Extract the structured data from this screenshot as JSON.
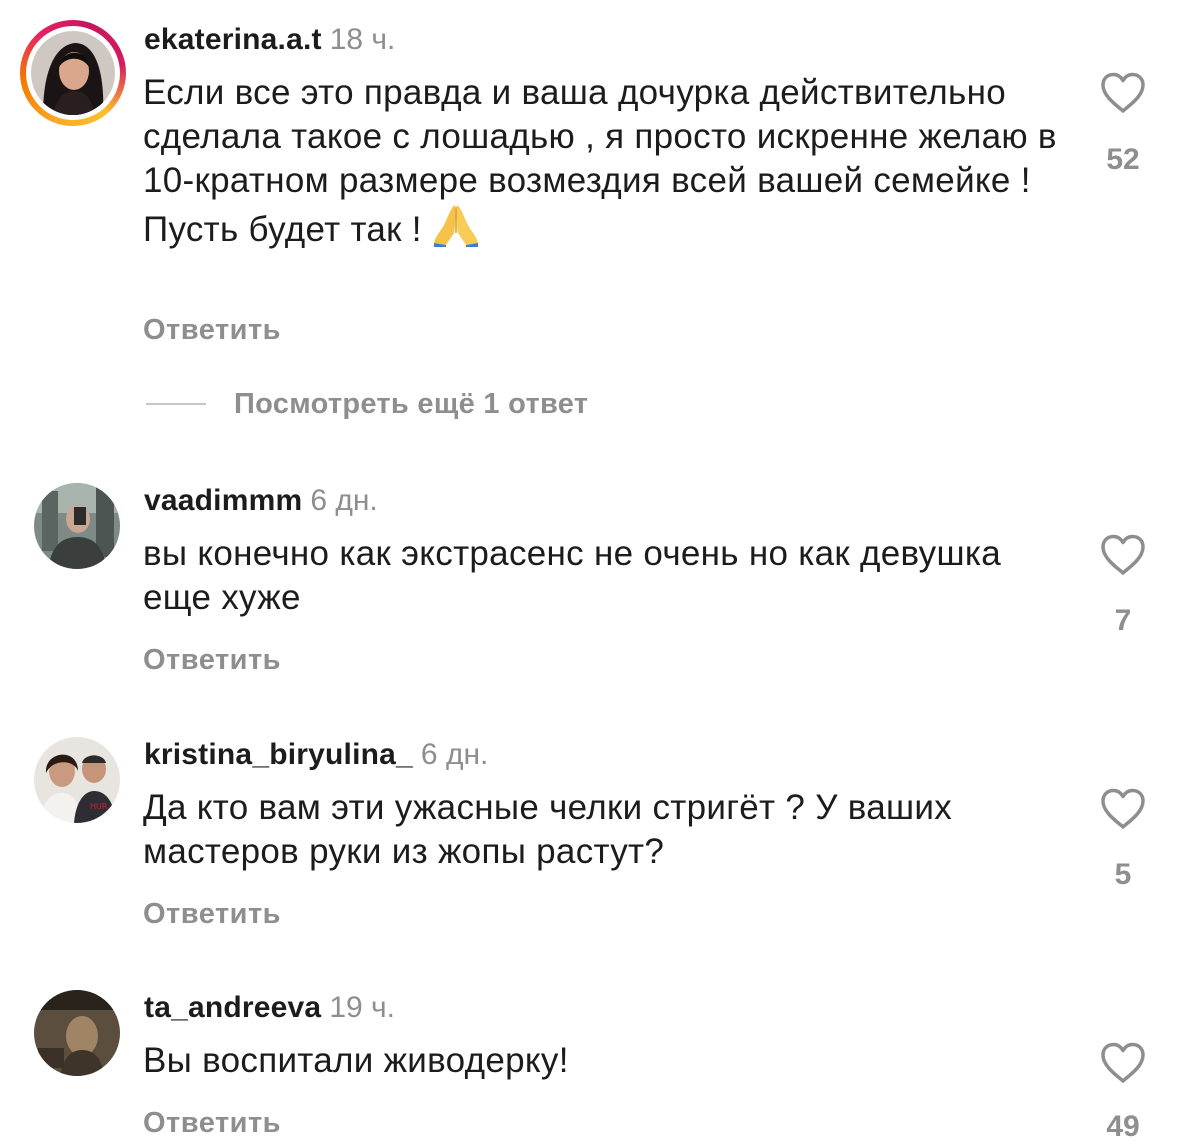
{
  "comments": [
    {
      "username": "ekaterina.a.t",
      "time": "18 ч.",
      "text": "Если все это правда и ваша дочурка действительно сделала такое с лошадью , я просто искренне желаю в 10-кратном размере возмездия всей вашей семейке ! Пусть будет так !",
      "emoji": "folded-hands-emoji",
      "likes": "52",
      "reply_label": "Ответить",
      "has_story_ring": true
    },
    {
      "username": "vaadimmm",
      "time": "6 дн.",
      "text": "вы конечно как экстрасенс не очень но как девушка еще хуже",
      "likes": "7",
      "reply_label": "Ответить"
    },
    {
      "username": "kristina_biryulina_",
      "time": "6 дн.",
      "text": "Да кто вам эти ужасные челки стригёт ? У ваших мастеров руки из жопы растут?",
      "likes": "5",
      "reply_label": "Ответить"
    },
    {
      "username": "ta_andreeva",
      "time": "19 ч.",
      "text": "Вы воспитали живодерку!",
      "likes": "49",
      "reply_label": "Ответить"
    }
  ],
  "view_replies_label": "Посмотреть ещё 1 ответ",
  "icons": {
    "like": "heart-outline-icon"
  },
  "colors": {
    "text": "#1c1c1c",
    "muted": "#8e8e8e",
    "story_ring": "#e91e63"
  }
}
